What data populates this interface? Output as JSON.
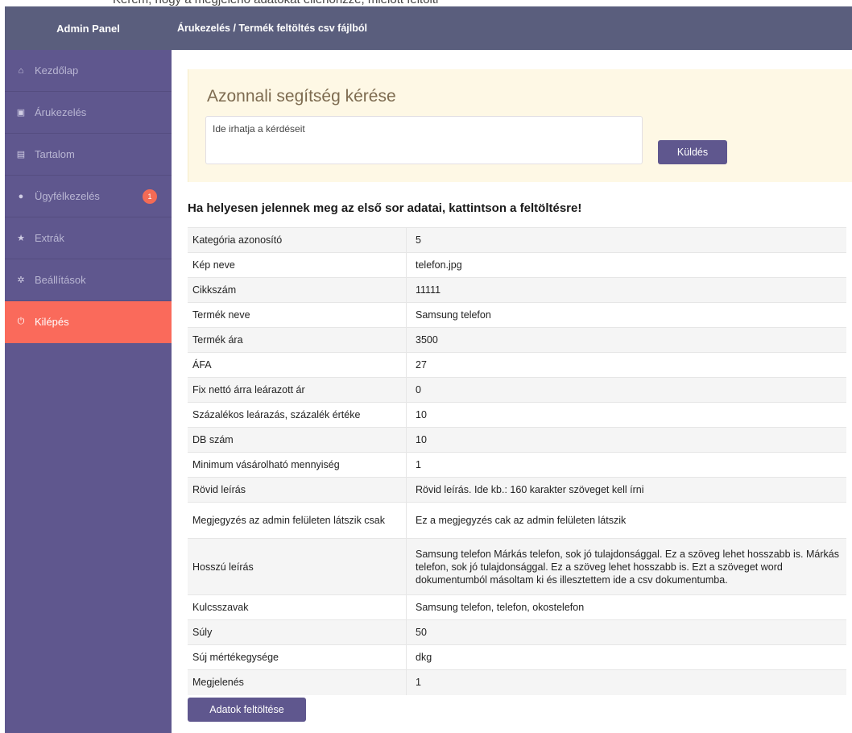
{
  "top_strip_text": "Kérem, hogy a megjelenő adatokat ellenőrizze, mielőtt feltölti",
  "brand": "Admin Panel",
  "breadcrumb": "Árukezelés / Termék feltöltés csv fájlból",
  "sidebar": {
    "items": [
      {
        "label": "Kezdőlap",
        "icon": "home-icon",
        "glyph": "⌂"
      },
      {
        "label": "Árukezelés",
        "icon": "cart-icon",
        "glyph": "▣"
      },
      {
        "label": "Tartalom",
        "icon": "file-icon",
        "glyph": "▤"
      },
      {
        "label": "Ügyfélkezelés",
        "icon": "user-icon",
        "glyph": "●",
        "badge": "1"
      },
      {
        "label": "Extrák",
        "icon": "star-icon",
        "glyph": "★"
      },
      {
        "label": "Beállítások",
        "icon": "gear-icon",
        "glyph": "✲"
      },
      {
        "label": "Kilépés",
        "icon": "power-icon",
        "glyph": "⏻",
        "active": true
      }
    ]
  },
  "help": {
    "title": "Azonnali segítség kérése",
    "placeholder": "Ide irhatja a kérdéseit",
    "send_label": "Küldés"
  },
  "notice": "Ha helyesen jelennek meg az első sor adatai, kattintson a feltöltésre!",
  "table": {
    "rows": [
      {
        "key": "Kategória azonosító",
        "value": "5"
      },
      {
        "key": "Kép neve",
        "value": "telefon.jpg"
      },
      {
        "key": "Cikkszám",
        "value": "11111"
      },
      {
        "key": "Termék neve",
        "value": "Samsung telefon"
      },
      {
        "key": "Termék ára",
        "value": "3500"
      },
      {
        "key": "ÁFA",
        "value": "27"
      },
      {
        "key": "Fix nettó árra leárazott ár",
        "value": "0"
      },
      {
        "key": "Százalékos leárazás, százalék értéke",
        "value": "10"
      },
      {
        "key": "DB szám",
        "value": "10"
      },
      {
        "key": "Minimum vásárolható mennyiség",
        "value": "1"
      },
      {
        "key": "Rövid leírás",
        "value": "Rövid leírás. Ide kb.: 160 karakter szöveget kell írni"
      },
      {
        "key": "Megjegyzés az admin felületen látszik csak",
        "value": "Ez a megjegyzés cak az admin felületen látszik"
      },
      {
        "key": "Hosszú leírás",
        "value": "Samsung telefon Márkás telefon, sok jó tulajdonsággal. Ez a szöveg lehet hosszabb is. Márkás telefon, sok jó tulajdonsággal. Ez a szöveg lehet hosszabb is. Ezt a szöveget word dokumentumból másoltam ki és illesztettem ide a csv dokumentumba."
      },
      {
        "key": "Kulcsszavak",
        "value": "Samsung telefon, telefon, okostelefon"
      },
      {
        "key": "Súly",
        "value": "50"
      },
      {
        "key": "Súj mértékegysége",
        "value": "dkg"
      },
      {
        "key": "Megjelenés",
        "value": "1"
      }
    ]
  },
  "upload_label": "Adatok feltöltése"
}
